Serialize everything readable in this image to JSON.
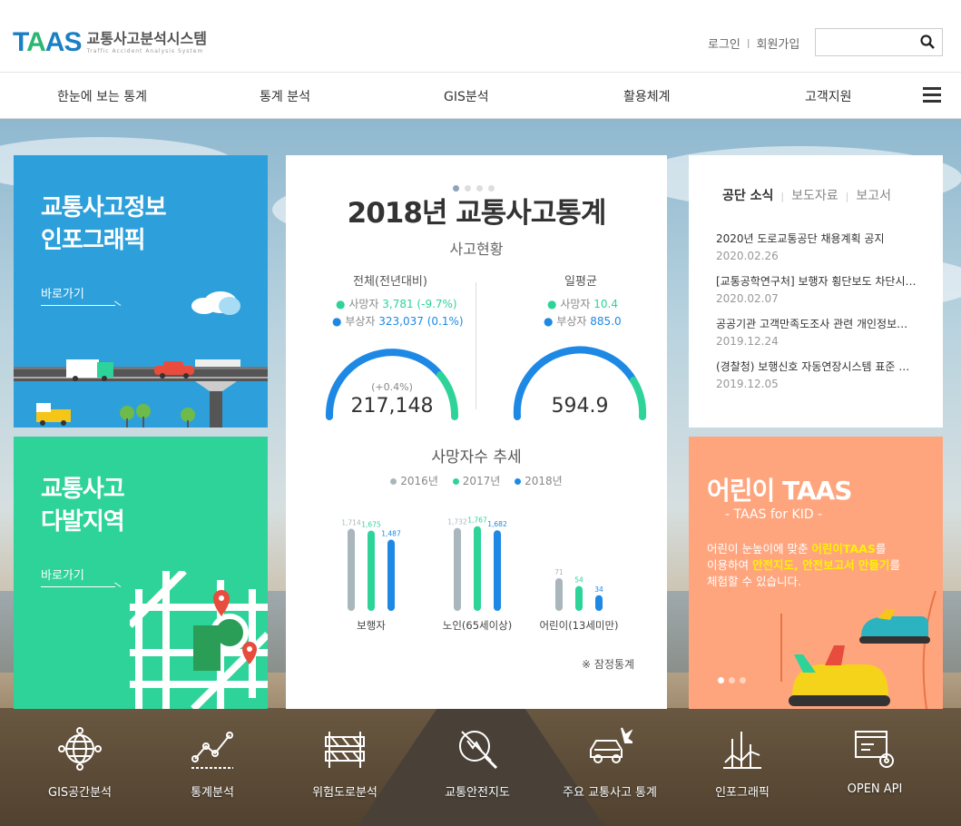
{
  "header": {
    "logo_mark": "TAAS",
    "logo_ko": "교통사고분석시스템",
    "logo_en": "Traffic Accident Analysis System",
    "login": "로그인",
    "sep": "l",
    "signup": "회원가입",
    "search_placeholder": ""
  },
  "nav": {
    "items": [
      "한눈에 보는 통계",
      "통계 분석",
      "GIS분석",
      "활용체계",
      "고객지원"
    ]
  },
  "info_card": {
    "title": "교통사고정보\n인포그래픽",
    "link": "바로가기"
  },
  "multi_card": {
    "title": "교통사고\n다발지역",
    "link": "바로가기"
  },
  "stats": {
    "title": "2018년 교통사고통계",
    "subtitle": "사고현황",
    "left": {
      "head": "전체(전년대비)",
      "dead_label": "사망자",
      "dead_value": "3,781 (-9.7%)",
      "inj_label": "부상자",
      "inj_value": "323,037 (0.1%)",
      "gauge_small": "(+0.4%)",
      "gauge_value": "217,148"
    },
    "right": {
      "head": "일평균",
      "dead_label": "사망자",
      "dead_value": "10.4",
      "inj_label": "부상자",
      "inj_value": "885.0",
      "gauge_value": "594.9"
    },
    "trend_title": "사망자수 추세",
    "note": "※ 잠정통계"
  },
  "chart_data": {
    "type": "bar",
    "title": "사망자수 추세",
    "categories": [
      "보행자",
      "노인(65세이상)",
      "어린이(13세미만)"
    ],
    "series": [
      {
        "name": "2016년",
        "color": "#a9b7bd",
        "values": [
          1714,
          1732,
          71
        ]
      },
      {
        "name": "2017년",
        "color": "#2ed39a",
        "values": [
          1675,
          1767,
          54
        ]
      },
      {
        "name": "2018년",
        "color": "#1e88e5",
        "values": [
          1487,
          1682,
          34
        ]
      }
    ],
    "labels": [
      [
        "1,714",
        "1,675",
        "1,487"
      ],
      [
        "1,732",
        "1,767",
        "1,682"
      ],
      [
        "71",
        "54",
        "34"
      ]
    ]
  },
  "news": {
    "tabs": [
      "공단 소식",
      "보도자료",
      "보고서"
    ],
    "items": [
      {
        "title": "2020년 도로교통공단 채용계획 공지",
        "date": "2020.02.26"
      },
      {
        "title": "[교통공학연구처] 보행자 횡단보도 차단시설 설치 효과 분석",
        "date": "2020.02.07"
      },
      {
        "title": "공공기관 고객만족도조사 관련 개인정보제공 안내",
        "date": "2019.12.24"
      },
      {
        "title": "(경찰청) 보행신호 자동연장시스템 표준 규격 안내",
        "date": "2019.12.05"
      }
    ]
  },
  "kid": {
    "title": "어린이 TAAS",
    "sub": "- TAAS for KID -",
    "d1": "어린이 눈높이에 맞춘 ",
    "d1y": "어린이TAAS",
    "d1b": "를",
    "d2": "이용하여 ",
    "d2y": "안전지도, 안전보고서 만들기",
    "d2b": "를",
    "d3": "체험할 수 있습니다."
  },
  "quick": [
    "GIS공간분석",
    "통계분석",
    "위험도로분석",
    "교통안전지도",
    "주요 교통사고 통계",
    "인포그래픽",
    "OPEN API"
  ]
}
